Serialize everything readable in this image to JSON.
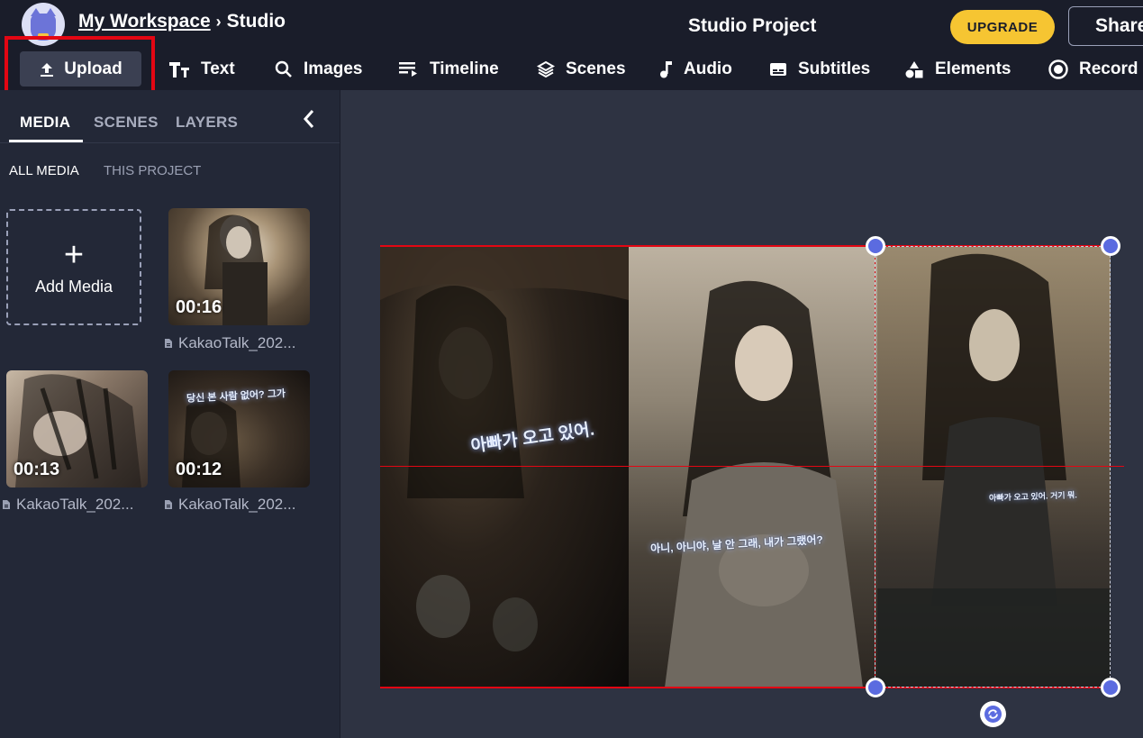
{
  "header": {
    "workspace": "My Workspace",
    "separator": "›",
    "section": "Studio",
    "project_title": "Studio Project",
    "upgrade_label": "UPGRADE",
    "share_label": "Share"
  },
  "toolbar": {
    "upload": "Upload",
    "text": "Text",
    "images": "Images",
    "timeline": "Timeline",
    "scenes": "Scenes",
    "audio": "Audio",
    "subtitles": "Subtitles",
    "elements": "Elements",
    "record": "Record"
  },
  "left_panel": {
    "tabs": [
      "MEDIA",
      "SCENES",
      "LAYERS"
    ],
    "subtabs": [
      "ALL MEDIA",
      "THIS PROJECT"
    ],
    "add_media": "Add Media",
    "items": [
      {
        "duration": "00:16",
        "name": "KakaoTalk_202..."
      },
      {
        "duration": "00:13",
        "name": "KakaoTalk_202..."
      },
      {
        "duration": "00:12",
        "name": "KakaoTalk_202..."
      }
    ]
  },
  "thumb_caption": "당신 본 사람 없어? 그가",
  "video_captions": {
    "left": "아빠가 오고 있어.",
    "middle": "아니, 아니야, 날 안 그래, 내가 그랬어?",
    "right": "아빠가 오고 있어. 거기 뭐."
  },
  "colors": {
    "background": "#1a1d2a",
    "panel": "#232837",
    "canvas": "#2e3342",
    "upgrade": "#f6c532",
    "handle": "#5b6be0",
    "highlight": "#e30613"
  }
}
